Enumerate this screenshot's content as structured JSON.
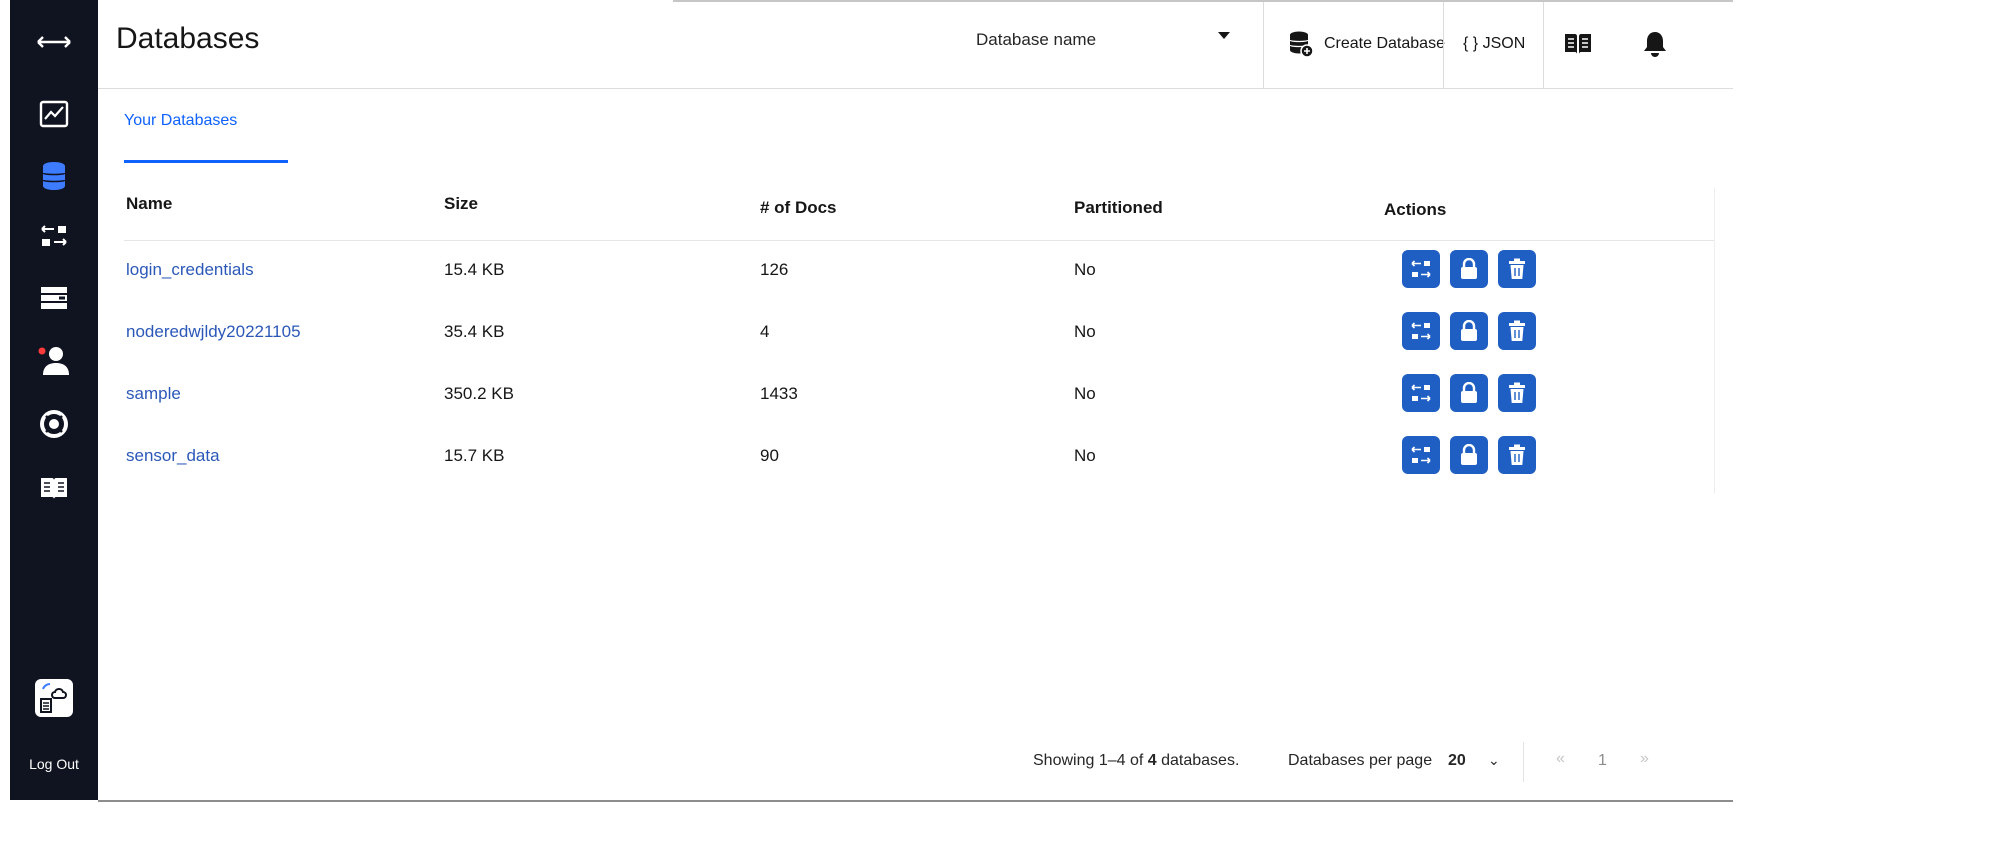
{
  "sidebar": {
    "icons": [
      "expand-icon",
      "dashboard-icon",
      "databases-icon",
      "replication-icon",
      "active-tasks-icon",
      "account-icon",
      "support-icon",
      "documentation-icon",
      "cloud-app-icon"
    ],
    "logout_label": "Log Out"
  },
  "header": {
    "title": "Databases",
    "db_select_label": "Database name",
    "create_label": "Create Database",
    "json_label": "{ } JSON"
  },
  "tabs": [
    {
      "label": "Your Databases"
    }
  ],
  "table": {
    "columns": [
      "Name",
      "Size",
      "# of Docs",
      "Partitioned",
      "Actions"
    ],
    "rows": [
      {
        "name": "login_credentials",
        "size": "15.4 KB",
        "docs": "126",
        "partitioned": "No"
      },
      {
        "name": "noderedwjldy20221105",
        "size": "35.4 KB",
        "docs": "4",
        "partitioned": "No"
      },
      {
        "name": "sample",
        "size": "350.2 KB",
        "docs": "1433",
        "partitioned": "No"
      },
      {
        "name": "sensor_data",
        "size": "15.7 KB",
        "docs": "90",
        "partitioned": "No"
      }
    ]
  },
  "footer": {
    "status_prefix": "Showing 1–4 of ",
    "status_count": "4",
    "status_suffix": " databases.",
    "per_page_label": "Databases per page",
    "per_page_value": "20",
    "current_page": "1",
    "prev_symbol": "«",
    "next_symbol": "»"
  },
  "colors": {
    "sidebar": "#101320",
    "accent": "#0f62fe",
    "action_button": "#1f5fc4",
    "link": "#2b58b8"
  }
}
